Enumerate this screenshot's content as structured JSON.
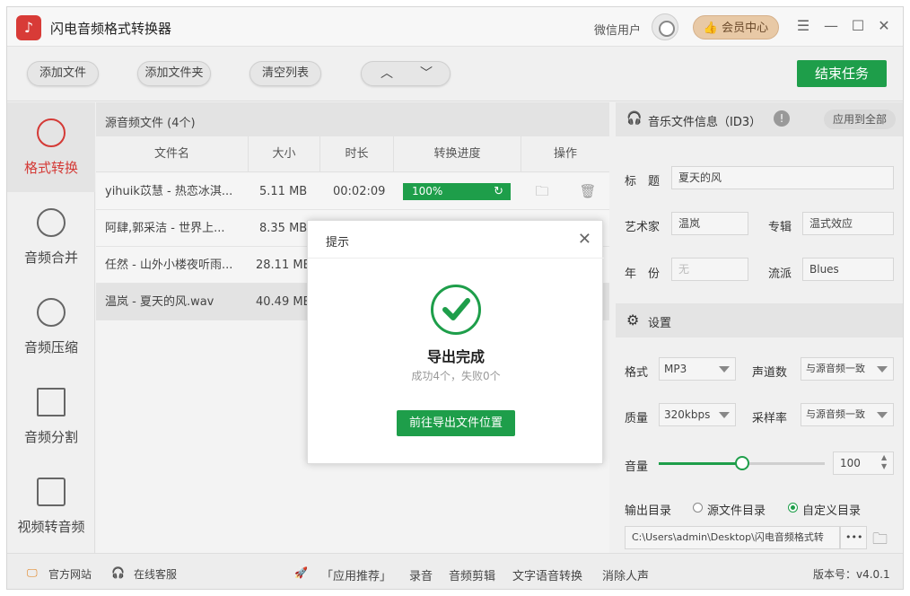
{
  "app": {
    "title": "闪电音频格式转换器",
    "logo_icon": "music-note-icon"
  },
  "user": {
    "name": "微信用户",
    "vip_label": "会员中心"
  },
  "toolbar": {
    "add_file": "添加文件",
    "add_folder": "添加文件夹",
    "clear_list": "清空列表",
    "up": "︿",
    "down": "﹀",
    "end_task": "结束任务"
  },
  "sidebar": {
    "items": [
      {
        "label": "格式转换",
        "icon": "convert-icon",
        "active": true
      },
      {
        "label": "音频合并",
        "icon": "merge-icon"
      },
      {
        "label": "音频压缩",
        "icon": "compress-icon"
      },
      {
        "label": "音频分割",
        "icon": "split-icon"
      },
      {
        "label": "视频转音频",
        "icon": "video-icon"
      }
    ]
  },
  "list": {
    "header": "源音频文件 (4个)",
    "columns": [
      "文件名",
      "大小",
      "时长",
      "转换进度",
      "操作"
    ],
    "rows": [
      {
        "name": "yihuik苡慧 - 热恋冰淇...",
        "size": "5.11 MB",
        "duration": "00:02:09",
        "progress": "100%"
      },
      {
        "name": "阿肆,郭采洁 - 世界上...",
        "size": "8.35 MB",
        "duration": "",
        "progress": ""
      },
      {
        "name": "任然 - 山外小楼夜听雨...",
        "size": "28.11 MB",
        "duration": "",
        "progress": ""
      },
      {
        "name": "温岚 - 夏天的风.wav",
        "size": "40.49 MB",
        "duration": "",
        "progress": ""
      }
    ]
  },
  "id3": {
    "title": "音乐文件信息（ID3）",
    "apply_all": "应用到全部",
    "title_label": "标　题",
    "title_value": "夏天的风",
    "artist_label": "艺术家",
    "artist_value": "温岚",
    "album_label": "专辑",
    "album_value": "温式效应",
    "year_label": "年　份",
    "year_placeholder": "无",
    "genre_label": "流派",
    "genre_value": "Blues"
  },
  "settings": {
    "title": "设置",
    "format_label": "格式",
    "format_value": "MP3",
    "channels_label": "声道数",
    "channels_value": "与源音频一致",
    "quality_label": "质量",
    "quality_value": "320kbps",
    "samplerate_label": "采样率",
    "samplerate_value": "与源音频一致",
    "volume_label": "音量",
    "volume_value": "100",
    "volume_fraction": 0.5,
    "output_label": "输出目录",
    "opt_source": "源文件目录",
    "opt_custom": "自定义目录",
    "output_path": "C:\\Users\\admin\\Desktop\\闪电音频格式转",
    "more": "•••"
  },
  "status": {
    "website": "官方网站",
    "support": "在线客服",
    "recommend": "「应用推荐」",
    "record": "录音",
    "edit": "音频剪辑",
    "tts": "文字语音转换",
    "vocal": "消除人声",
    "version": "版本号：v4.0.1"
  },
  "dialog": {
    "title": "提示",
    "message": "导出完成",
    "detail": "成功4个，失败0个",
    "button": "前往导出文件位置"
  },
  "colors": {
    "accent": "#1e9e4a",
    "active": "#d43a36"
  }
}
